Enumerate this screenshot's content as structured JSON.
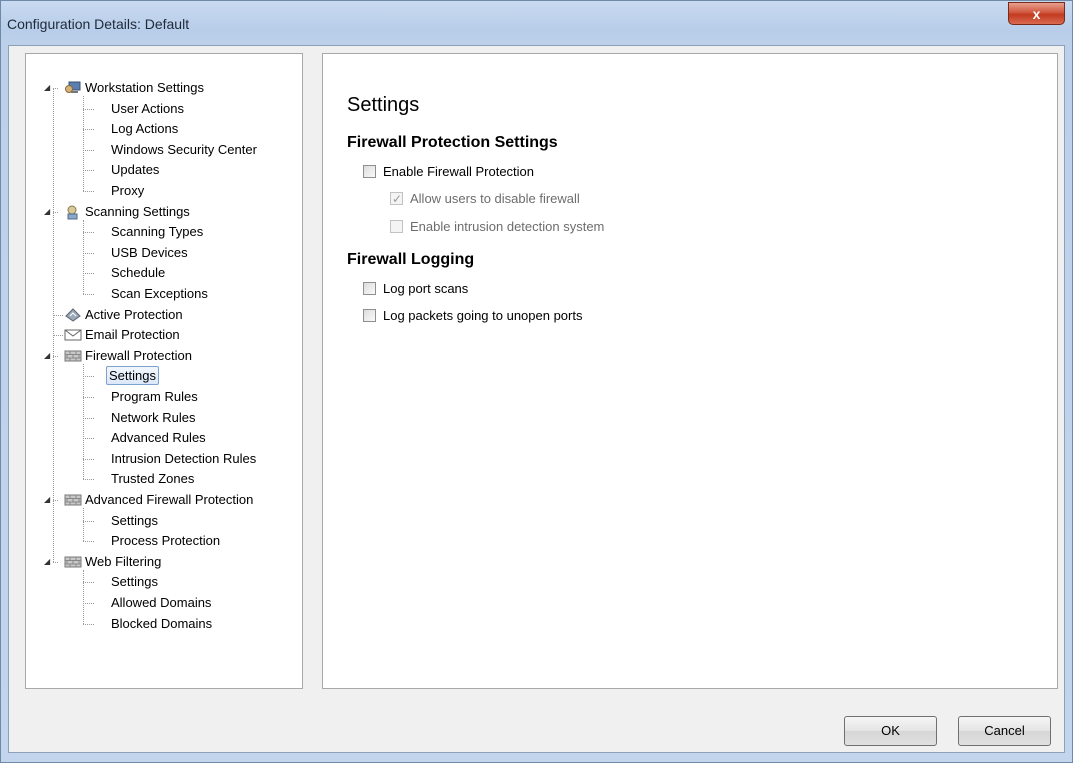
{
  "window": {
    "title": "Configuration Details: Default",
    "close_glyph": "x"
  },
  "tree": [
    {
      "label": "Workstation Settings",
      "icon": "workstation-icon",
      "children": [
        "User Actions",
        "Log Actions",
        "Windows Security Center",
        "Updates",
        "Proxy"
      ]
    },
    {
      "label": "Scanning Settings",
      "icon": "scanning-icon",
      "children": [
        "Scanning Types",
        "USB Devices",
        "Schedule",
        "Scan Exceptions"
      ]
    },
    {
      "label": "Active Protection",
      "icon": "active-protection-icon",
      "children": []
    },
    {
      "label": "Email Protection",
      "icon": "envelope-icon",
      "children": []
    },
    {
      "label": "Firewall Protection",
      "icon": "firewall-icon",
      "children": [
        "Settings",
        "Program Rules",
        "Network Rules",
        "Advanced Rules",
        "Intrusion Detection Rules",
        "Trusted Zones"
      ]
    },
    {
      "label": "Advanced Firewall Protection",
      "icon": "firewall-icon",
      "children": [
        "Settings",
        "Process Protection"
      ]
    },
    {
      "label": "Web Filtering",
      "icon": "firewall-icon",
      "children": [
        "Settings",
        "Allowed Domains",
        "Blocked Domains"
      ]
    }
  ],
  "selected_node": "Firewall Protection / Settings",
  "panel": {
    "title": "Settings",
    "section1": "Firewall Protection Settings",
    "enable_firewall": {
      "label": "Enable Firewall Protection",
      "checked": false
    },
    "allow_disable": {
      "label": "Allow users to disable firewall",
      "checked": true,
      "disabled": true
    },
    "enable_ids": {
      "label": "Enable intrusion detection system",
      "checked": false,
      "disabled": true
    },
    "section2": "Firewall Logging",
    "log_port_scans": {
      "label": "Log port scans",
      "checked": false
    },
    "log_packets": {
      "label": "Log packets going to unopen ports",
      "checked": false
    }
  },
  "buttons": {
    "ok": "OK",
    "cancel": "Cancel"
  }
}
